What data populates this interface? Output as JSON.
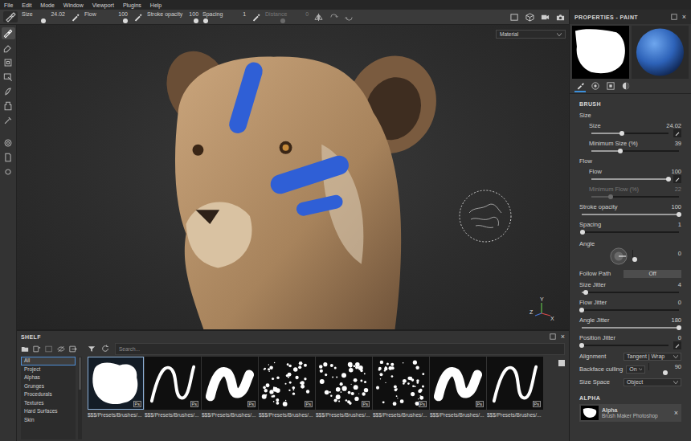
{
  "menu": [
    "File",
    "Edit",
    "Mode",
    "Window",
    "Viewport",
    "Plugins",
    "Help"
  ],
  "toolbar": {
    "sliders": [
      {
        "label": "Size",
        "reading": "24.02",
        "level": 0.5,
        "disabled": false,
        "has_pressure": true
      },
      {
        "label": "Flow",
        "reading": "100",
        "level": 1,
        "disabled": false,
        "has_pressure": true
      },
      {
        "label": "Stroke opacity",
        "reading": "100",
        "level": 1,
        "disabled": false,
        "has_pressure": false
      },
      {
        "label": "Spacing",
        "reading": "1",
        "level": 0.02,
        "disabled": false,
        "has_pressure": true
      },
      {
        "label": "Distance",
        "reading": "0",
        "level": 0.4,
        "disabled": true,
        "has_pressure": false
      }
    ]
  },
  "tools": [
    {
      "selected": true
    },
    {
      "selected": false
    },
    {
      "selected": false
    },
    {
      "selected": false
    },
    {
      "selected": false
    },
    {
      "selected": false
    },
    {
      "selected": false
    },
    {
      "selected": false
    },
    {
      "selected": false
    },
    {
      "selected": false
    }
  ],
  "viewport": {
    "mode": "Material",
    "axes": [
      "Y",
      "Z",
      "X"
    ]
  },
  "properties": {
    "title": "PROPERTIES - PAINT",
    "close": "×",
    "tabs": [
      {
        "selected": true
      },
      {
        "selected": false
      },
      {
        "selected": false
      },
      {
        "selected": false
      }
    ],
    "brush": {
      "title": "BRUSH",
      "rows": [
        {
          "kind": "group",
          "label": "Size",
          "rows": [
            {
              "kind": "slider",
              "label": "Size",
              "reading": "24.02",
              "level": 0.4,
              "disabled": false,
              "button": true
            },
            {
              "kind": "slider",
              "label": "Minimum Size (%)",
              "reading": "39",
              "level": 0.33,
              "disabled": false,
              "button": false
            }
          ]
        },
        {
          "kind": "group",
          "label": "Flow",
          "rows": [
            {
              "kind": "slider",
              "label": "Flow",
              "reading": "100",
              "level": 1,
              "disabled": false,
              "button": true
            },
            {
              "kind": "slider",
              "label": "Minimum Flow (%)",
              "reading": "22",
              "level": 0.22,
              "disabled": true,
              "button": false
            }
          ]
        },
        {
          "kind": "slider",
          "label": "Stroke opacity",
          "reading": "100",
          "level": 1,
          "disabled": false,
          "button": false
        },
        {
          "kind": "slider",
          "label": "Spacing",
          "reading": "1",
          "level": 0.01,
          "disabled": false,
          "button": false
        },
        {
          "kind": "dial",
          "label": "Angle",
          "reading": "0",
          "level": 0
        },
        {
          "kind": "toggle",
          "label": "Follow Path",
          "value": "Off",
          "on": false
        },
        {
          "kind": "slider",
          "label": "Size Jitter",
          "reading": "4",
          "level": 0.04,
          "disabled": false,
          "button": false
        },
        {
          "kind": "slider",
          "label": "Flow Jitter",
          "reading": "0",
          "level": 0,
          "disabled": false,
          "button": false
        },
        {
          "kind": "slider",
          "label": "Angle Jitter",
          "reading": "180",
          "level": 1,
          "disabled": false,
          "button": false
        },
        {
          "kind": "slider",
          "label": "Position Jitter",
          "reading": "0",
          "level": 0,
          "disabled": false,
          "button": true
        },
        {
          "kind": "select",
          "label": "Alignment",
          "value": "Tangent | Wrap"
        },
        {
          "kind": "select-slider",
          "label": "Backface culling",
          "value": "On",
          "reading": "90",
          "level": 0.5
        },
        {
          "kind": "select",
          "label": "Size Space",
          "value": "Object"
        }
      ]
    },
    "alpha": {
      "title": "ALPHA",
      "name": "Alpha",
      "source": "Brush Maker Photoshop",
      "close": "×"
    }
  },
  "shelf": {
    "title": "SHELF",
    "close": "×",
    "search": {
      "placeholder": "Search..."
    },
    "categories": [
      {
        "label": "All",
        "selected": true
      },
      {
        "label": "Project",
        "selected": false
      },
      {
        "label": "Alphas",
        "selected": false
      },
      {
        "label": "Grunges",
        "selected": false
      },
      {
        "label": "Procedurals",
        "selected": false
      },
      {
        "label": "Textures",
        "selected": false
      },
      {
        "label": "Hard Surfaces",
        "selected": false
      },
      {
        "label": "Skin",
        "selected": false
      }
    ],
    "items": [
      {
        "label": "$$$/Presets/Brushes/...",
        "badge": "Ps",
        "kind": "blob",
        "selected": true
      },
      {
        "label": "$$$/Presets/Brushes/...",
        "badge": "Ps",
        "kind": "wave",
        "selected": false
      },
      {
        "label": "$$$/Presets/Brushes/...",
        "badge": "Ps",
        "kind": "thick",
        "selected": false
      },
      {
        "label": "$$$/Presets/Brushes/...",
        "badge": "Ps",
        "kind": "spatter",
        "selected": false
      },
      {
        "label": "$$$/Presets/Brushes/...",
        "badge": "Ps",
        "kind": "spatter",
        "selected": false
      },
      {
        "label": "$$$/Presets/Brushes/...",
        "badge": "Ps",
        "kind": "spatter",
        "selected": false
      },
      {
        "label": "$$$/Presets/Brushes/...",
        "badge": "Ps",
        "kind": "thick",
        "selected": false
      },
      {
        "label": "$$$/Presets/Brushes/...",
        "badge": "Ps",
        "kind": "wave",
        "selected": false
      }
    ]
  }
}
